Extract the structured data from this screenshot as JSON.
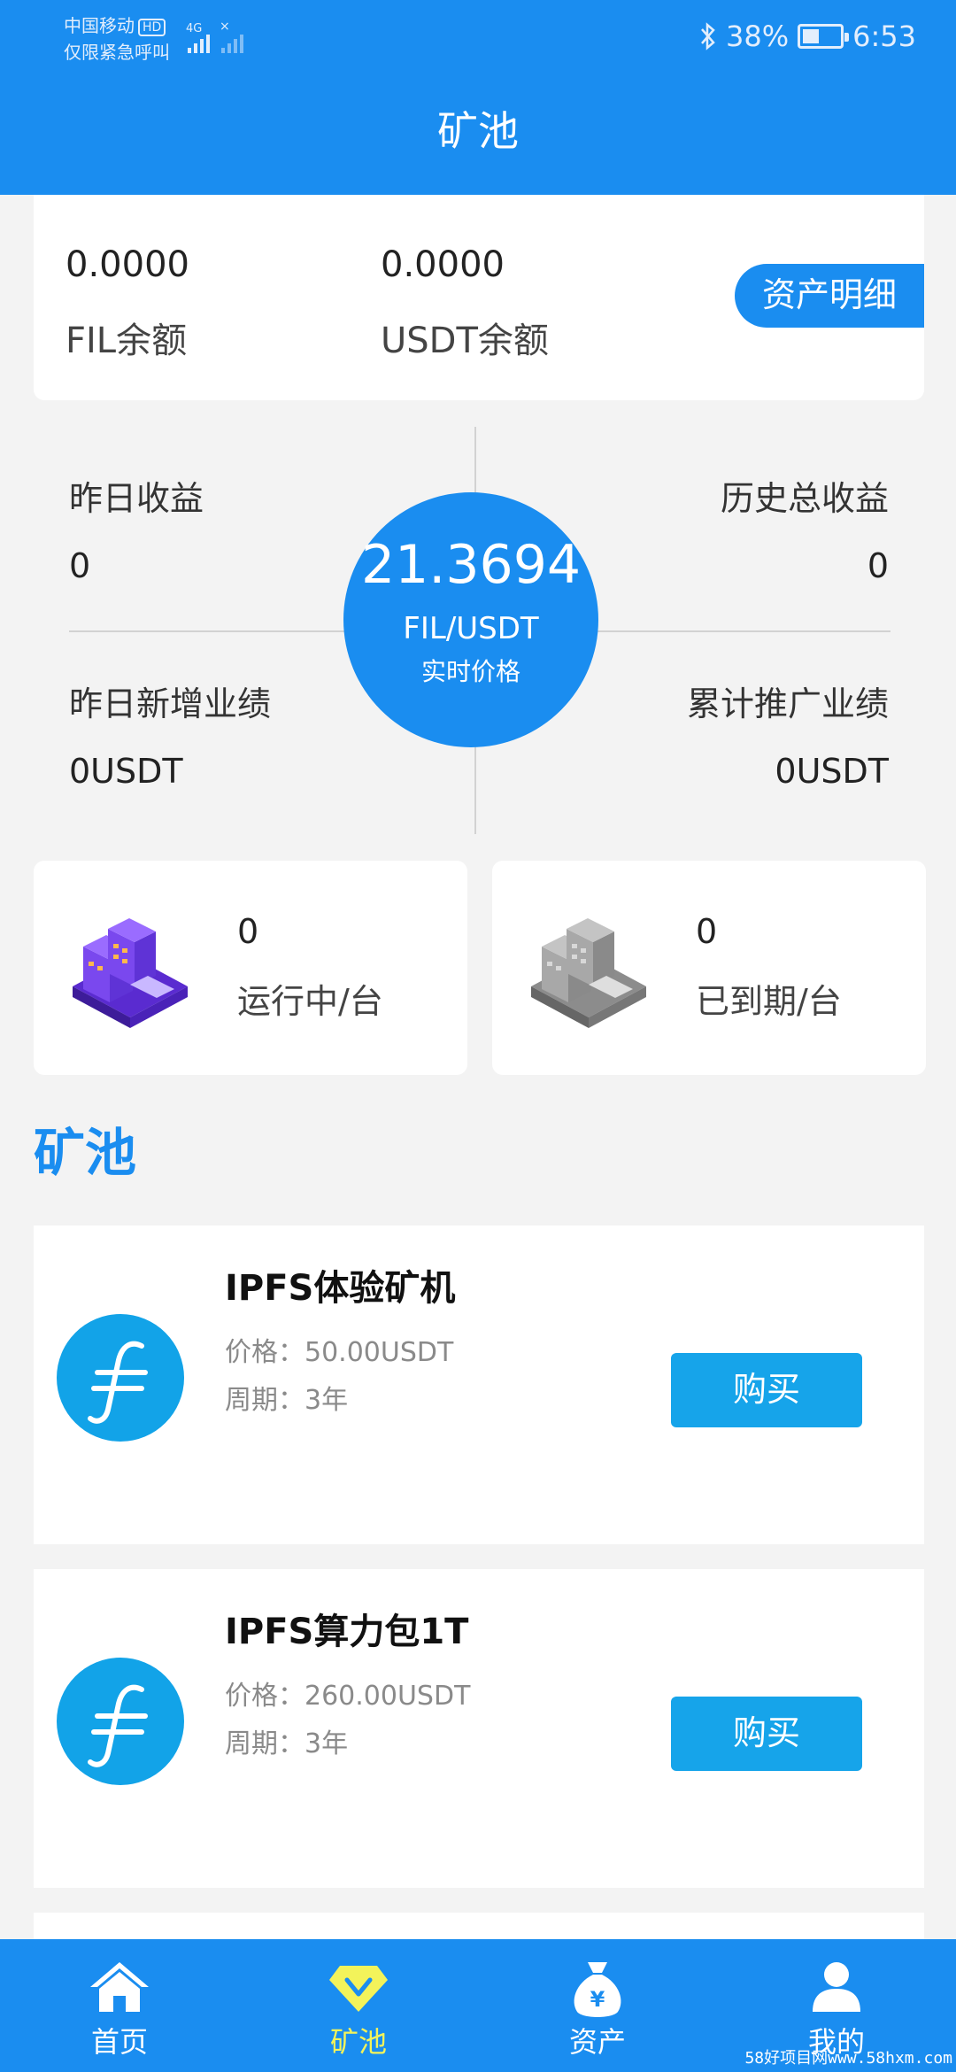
{
  "status_bar": {
    "carrier": "中国移动",
    "carrier_badge": "HD",
    "emergency": "仅限紧急呼叫",
    "network": "4G",
    "battery": "38%",
    "time": "6:53"
  },
  "header": {
    "title": "矿池"
  },
  "balance": {
    "fil_value": "0.0000",
    "fil_label": "FIL余额",
    "usdt_value": "0.0000",
    "usdt_label": "USDT余额",
    "detail_button": "资产明细"
  },
  "stats": {
    "yesterday_income_label": "昨日收益",
    "yesterday_income_value": "0",
    "total_income_label": "历史总收益",
    "total_income_value": "0",
    "yesterday_perf_label": "昨日新增业绩",
    "yesterday_perf_value": "0USDT",
    "total_promo_label": "累计推广业绩",
    "total_promo_value": "0USDT"
  },
  "price": {
    "value": "21.3694",
    "pair": "FIL/USDT",
    "label": "实时价格"
  },
  "machines": {
    "running_count": "0",
    "running_label": "运行中/台",
    "expired_count": "0",
    "expired_label": "已到期/台"
  },
  "section_title": "矿池",
  "products": [
    {
      "name": "IPFS体验矿机",
      "price": "价格：50.00USDT",
      "period": "周期：3年",
      "button": "购买"
    },
    {
      "name": "IPFS算力包1T",
      "price": "价格：260.00USDT",
      "period": "周期：3年",
      "button": "购买"
    }
  ],
  "nav": [
    {
      "label": "首页",
      "icon": "home-icon"
    },
    {
      "label": "矿池",
      "icon": "diamond-icon",
      "active": true
    },
    {
      "label": "资产",
      "icon": "money-bag-icon"
    },
    {
      "label": "我的",
      "icon": "user-icon"
    }
  ],
  "watermark": "58好项目网www.58hxm.com",
  "colors": {
    "primary": "#1a8df0",
    "button": "#16a4ea",
    "active_nav": "#f3f35a",
    "fil_logo": "#12a3e8"
  }
}
